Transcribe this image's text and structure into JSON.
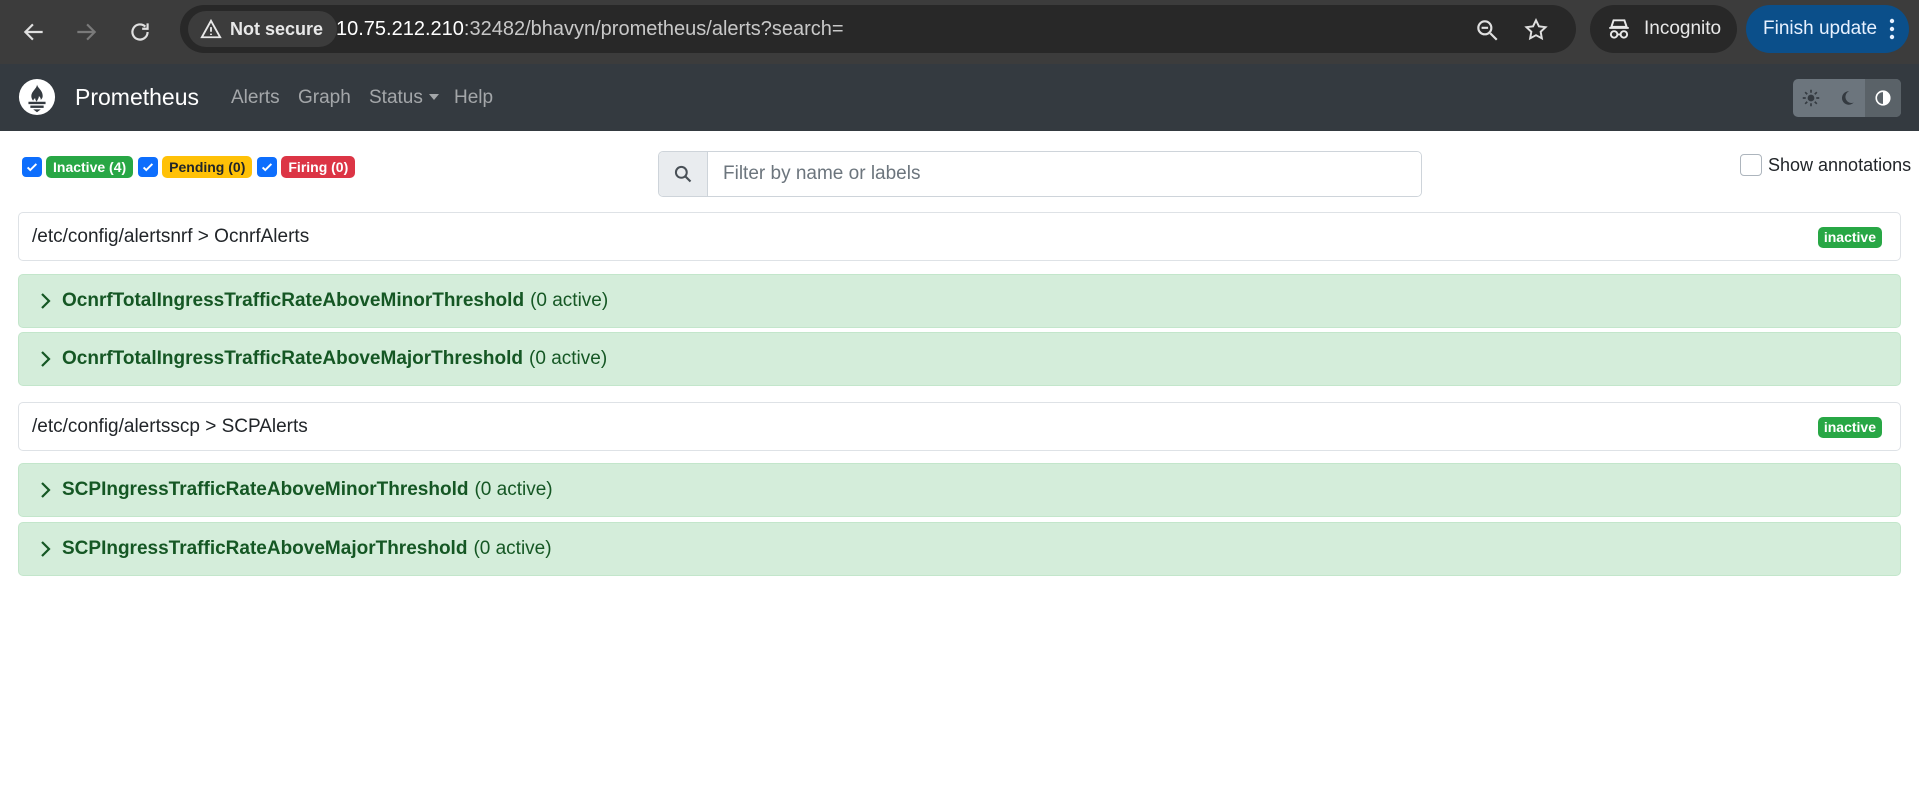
{
  "browser": {
    "security_label": "Not secure",
    "url_host": "10.75.212.210",
    "url_rest": ":32482/bhavyn/prometheus/alerts?search=",
    "incognito_label": "Incognito",
    "update_label": "Finish update"
  },
  "navbar": {
    "brand": "Prometheus",
    "links": [
      "Alerts",
      "Graph",
      "Status",
      "Help"
    ]
  },
  "filters": {
    "inactive": "Inactive (4)",
    "pending": "Pending (0)",
    "firing": "Firing (0)",
    "search_placeholder": "Filter by name or labels",
    "show_annotations": "Show annotations"
  },
  "groups": [
    {
      "path": "/etc/config/alertsnrf > OcnrfAlerts",
      "state": "inactive",
      "rules": [
        {
          "name": "OcnrfTotalIngressTrafficRateAboveMinorThreshold",
          "count": "(0 active)"
        },
        {
          "name": "OcnrfTotalIngressTrafficRateAboveMajorThreshold",
          "count": "(0 active)"
        }
      ]
    },
    {
      "path": "/etc/config/alertsscp > SCPAlerts",
      "state": "inactive",
      "rules": [
        {
          "name": "SCPIngressTrafficRateAboveMinorThreshold",
          "count": "(0 active)"
        },
        {
          "name": "SCPIngressTrafficRateAboveMajorThreshold",
          "count": "(0 active)"
        }
      ]
    }
  ],
  "colors": {
    "navbar": "#343a40",
    "success": "#28a745",
    "warning": "#ffc107",
    "danger": "#dc3545",
    "rule_bg": "#d4edda",
    "rule_text": "#155724"
  }
}
